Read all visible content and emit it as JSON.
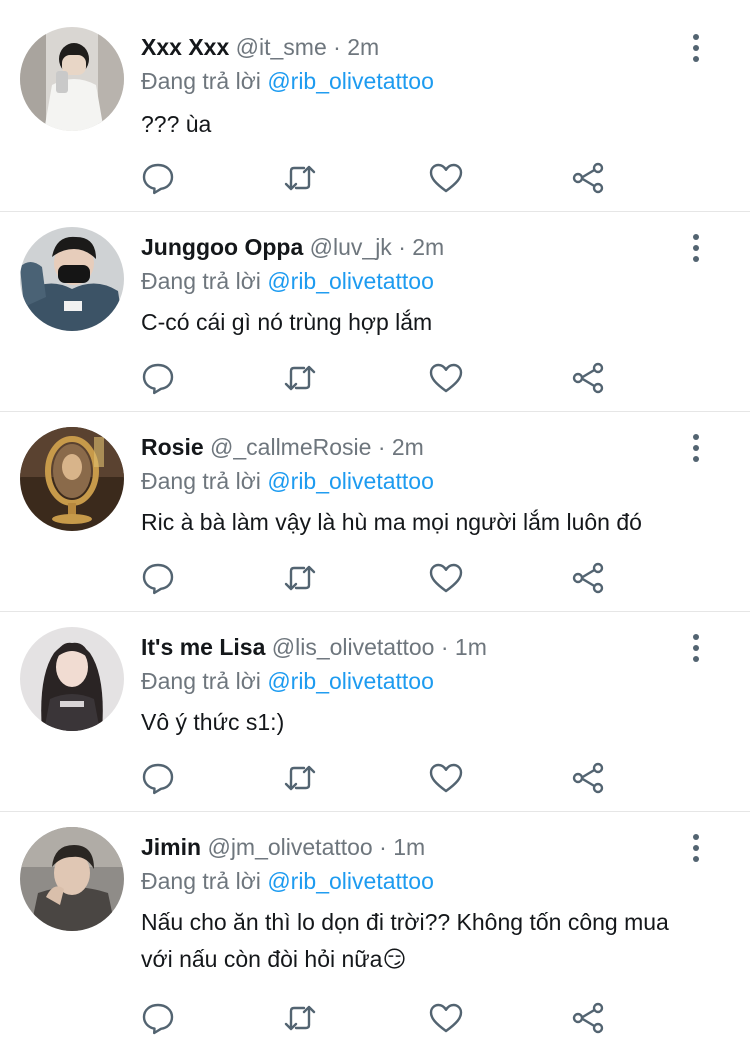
{
  "reply_prefix": "Đang trả lời",
  "separator": "·",
  "tweets": [
    {
      "name": "Xxx Xxx",
      "handle": "@it_sme",
      "time": "2m",
      "reply_to": "@rib_olivetattoo",
      "text": "??? ùa",
      "avatar": "avatar-mirror-selfie"
    },
    {
      "name": "Junggoo Oppa",
      "handle": "@luv_jk",
      "time": "2m",
      "reply_to": "@rib_olivetattoo",
      "text": "C-có cái gì nó trùng hợp lắm",
      "avatar": "avatar-masked-man"
    },
    {
      "name": "Rosie",
      "handle": "@_callmeRosie",
      "time": "2m",
      "reply_to": "@rib_olivetattoo",
      "text": "Ric à bà làm vậy là hù ma mọi người lắm luôn đó",
      "avatar": "avatar-golden-mirror"
    },
    {
      "name": "It's me Lisa",
      "handle": "@lis_olivetattoo",
      "time": "1m",
      "reply_to": "@rib_olivetattoo",
      "text": "Vô ý thức s1:)",
      "avatar": "avatar-woman"
    },
    {
      "name": "Jimin",
      "handle": "@jm_olivetattoo",
      "time": "1m",
      "reply_to": "@rib_olivetattoo",
      "text": "Nấu cho ăn thì lo dọn đi trời?? Không tốn công mua với nấu còn đòi hỏi nữa😏",
      "avatar": "avatar-man"
    }
  ],
  "colors": {
    "mention": "#1d9bf0",
    "secondary_text": "#6e767d",
    "icon": "#536471",
    "divider": "#e6e6e6"
  }
}
